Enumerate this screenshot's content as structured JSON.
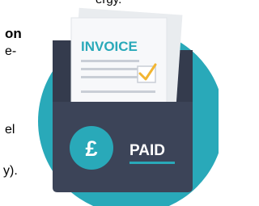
{
  "fragments": {
    "top": "ergy.",
    "bold": "on",
    "hyphen": "e-",
    "el": "el",
    "y": "y)."
  },
  "illustration": {
    "invoice_label": "INVOICE",
    "paid_label": "PAID",
    "currency_symbol": "£",
    "colors": {
      "circle": "#29A9B9",
      "folder": "#3C4458",
      "paper": "#F4F5F7",
      "accent": "#29A9B9",
      "check": "#F2B531"
    }
  }
}
